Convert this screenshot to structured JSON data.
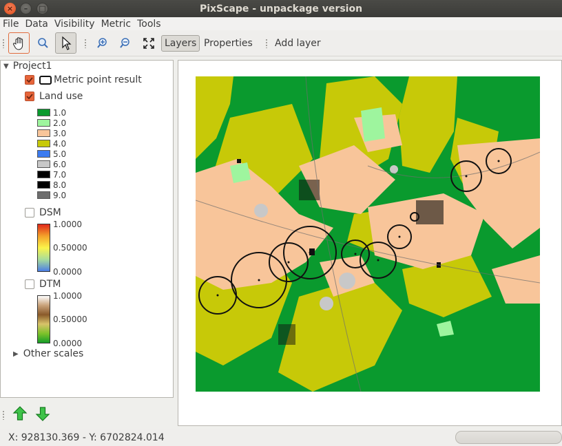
{
  "window": {
    "title": "PixScape - unpackage version",
    "controls": {
      "close_icon": "×",
      "min_icon": "–",
      "max_icon": "□"
    }
  },
  "menubar": {
    "items": [
      "File",
      "Data",
      "Visibility",
      "Metric",
      "Tools"
    ]
  },
  "toolbar": {
    "tools": [
      "pan-hand-icon",
      "zoom-tool-icon",
      "select-arrow-icon",
      "zoom-in-icon",
      "zoom-out-icon",
      "zoom-full-extent-icon"
    ],
    "layers_label": "Layers",
    "properties_label": "Properties",
    "add_layer_label": "Add layer"
  },
  "layers": {
    "project_name": "Project1",
    "metric_layer": "Metric point result",
    "landuse_layer": "Land use",
    "landuse_legend": [
      {
        "label": "1.0",
        "color": "#0a9a2e"
      },
      {
        "label": "2.0",
        "color": "#9ef59e"
      },
      {
        "label": "3.0",
        "color": "#f8c59a"
      },
      {
        "label": "4.0",
        "color": "#c7c908"
      },
      {
        "label": "5.0",
        "color": "#3b7bf0"
      },
      {
        "label": "6.0",
        "color": "#c8c8c8"
      },
      {
        "label": "7.0",
        "color": "#000000"
      },
      {
        "label": "8.0",
        "color": "#000000"
      },
      {
        "label": "9.0",
        "color": "#6e6e6e"
      }
    ],
    "dsm_layer": "DSM",
    "dsm_ramp": {
      "max": "1.0000",
      "mid": "0.50000",
      "min": "0.0000"
    },
    "dtm_layer": "DTM",
    "dtm_ramp": {
      "max": "1.0000",
      "mid": "0.50000",
      "min": "0.0000"
    },
    "other_scales": "Other scales"
  },
  "bottom_tools": {
    "up": "move-layer-up-icon",
    "down": "move-layer-down-icon"
  },
  "status": {
    "coordinates": "X: 928130.369 - Y: 6702824.014"
  },
  "colors": {
    "accent": "#e7653a",
    "titlebar": "#3c3b37",
    "forest": "#0a9a2e",
    "crop": "#f8c59a",
    "meadow": "#c7c908"
  }
}
